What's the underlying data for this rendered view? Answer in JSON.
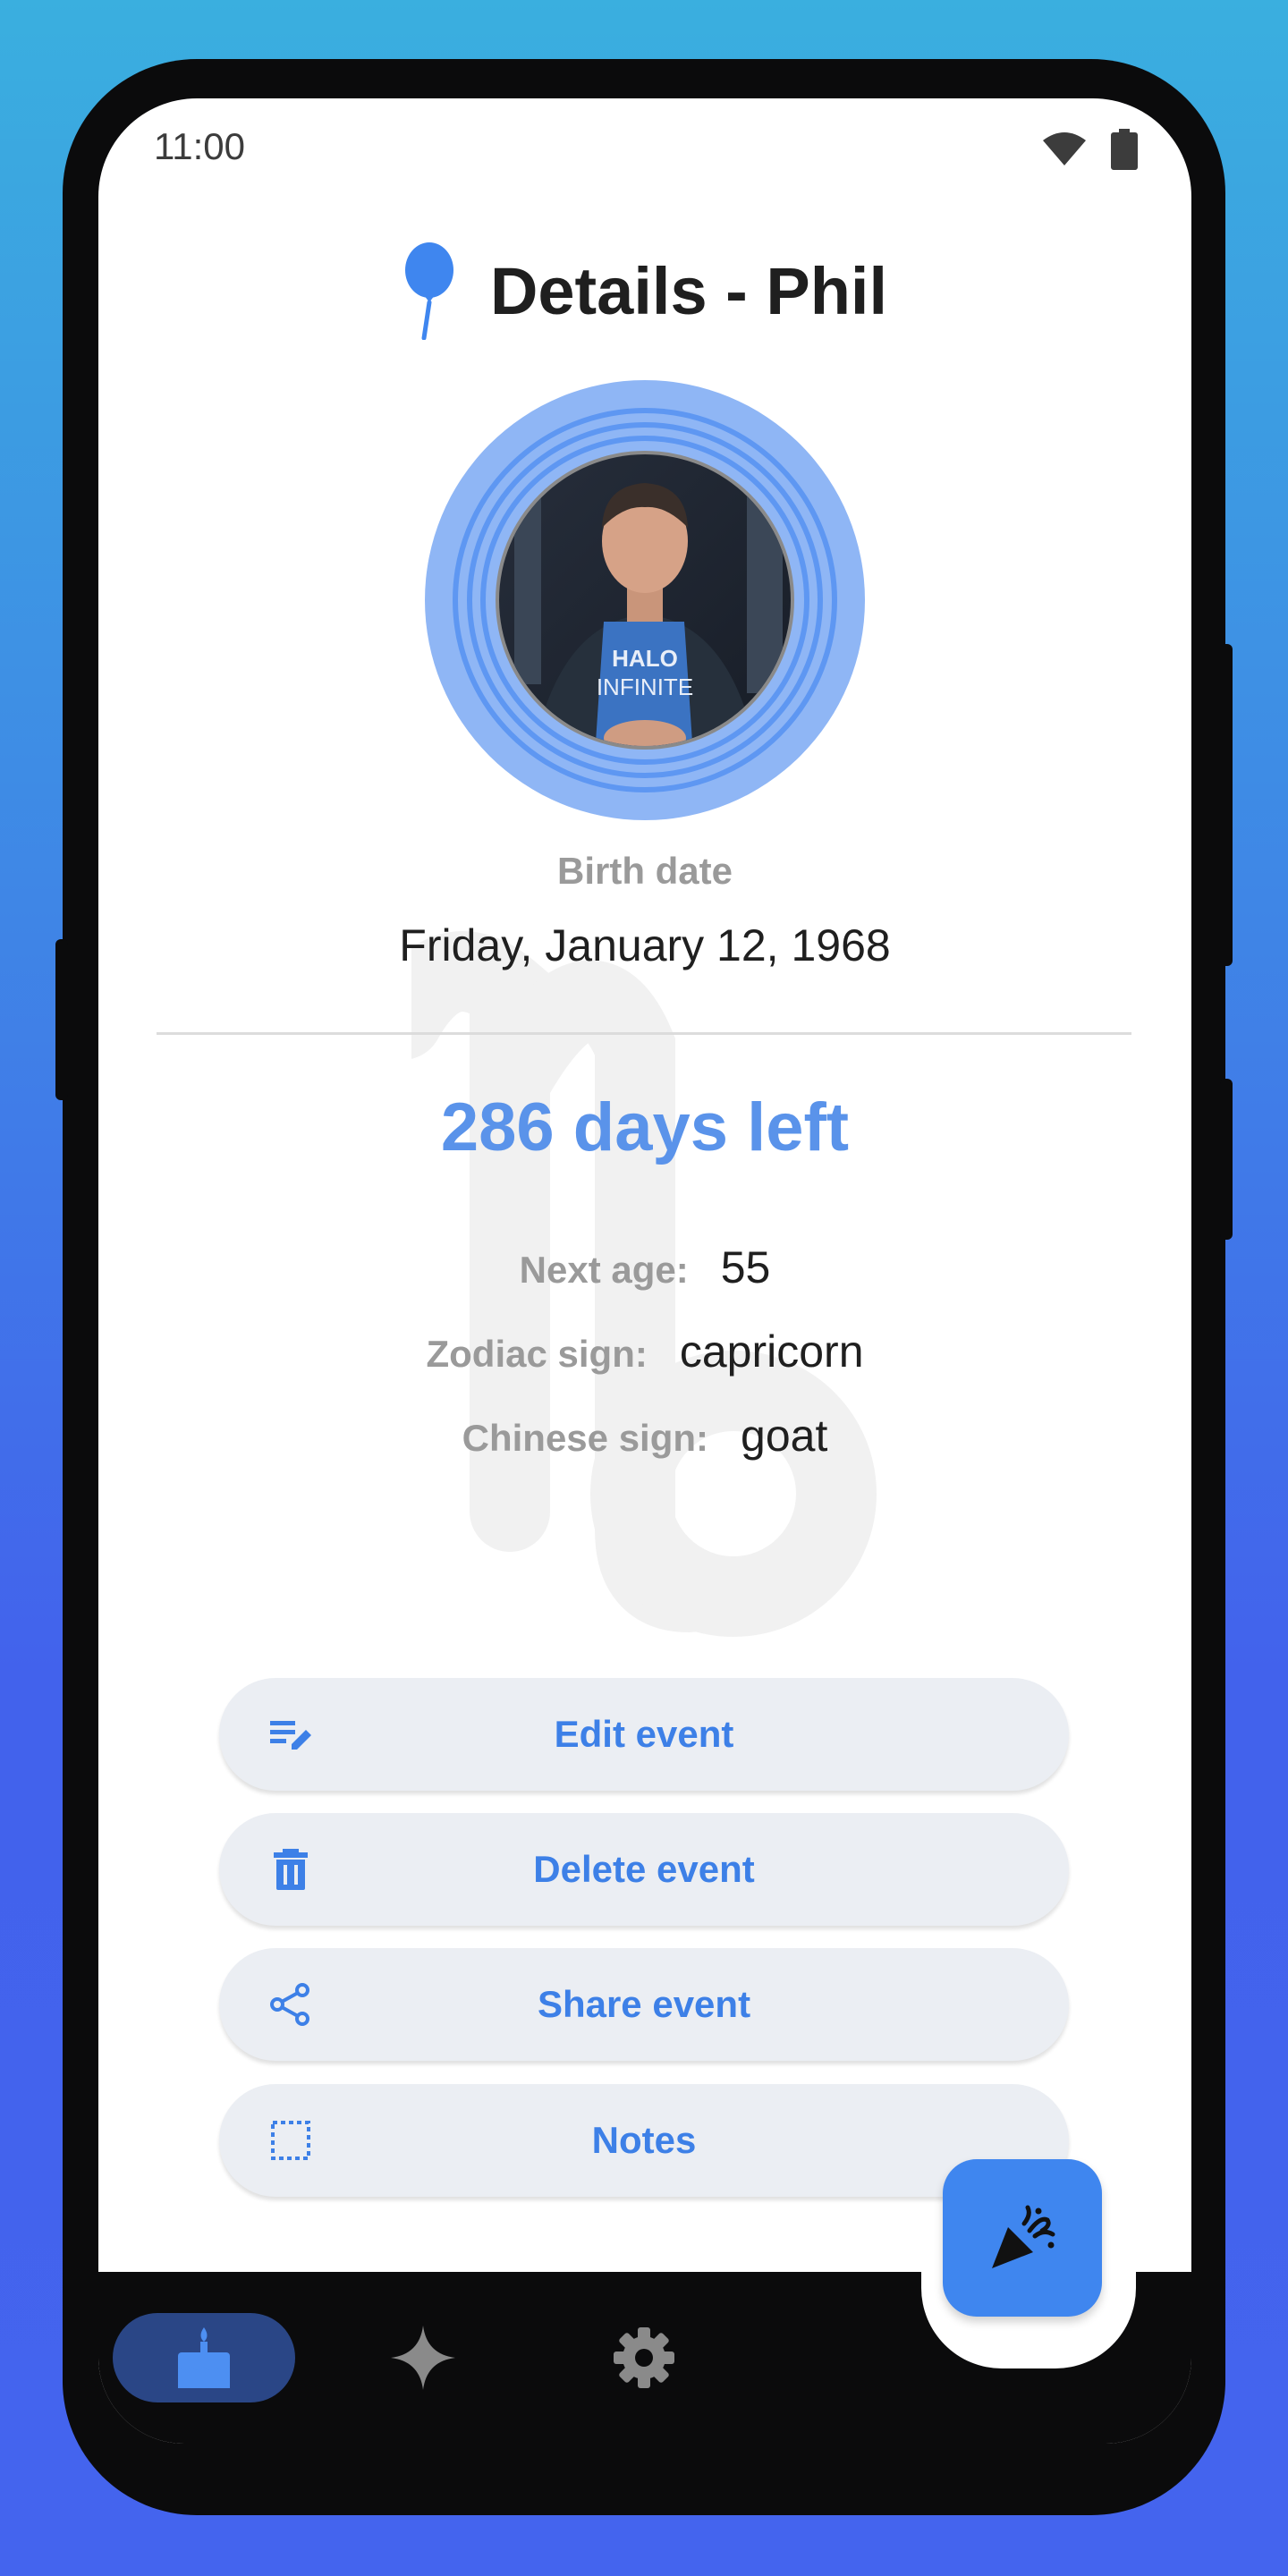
{
  "status_bar": {
    "time": "11:00"
  },
  "header": {
    "title": "Details - Phil"
  },
  "birth": {
    "label": "Birth date",
    "value": "Friday, January 12, 1968"
  },
  "countdown": {
    "text": "286 days left"
  },
  "info": [
    {
      "label": "Next age:",
      "value": "55"
    },
    {
      "label": "Zodiac sign:",
      "value": "capricorn"
    },
    {
      "label": "Chinese sign:",
      "value": "goat"
    }
  ],
  "actions": {
    "edit": "Edit event",
    "delete": "Delete event",
    "share": "Share event",
    "notes": "Notes"
  },
  "colors": {
    "accent": "#3d80e7",
    "days_left": "#5a93ea",
    "avatar_ring": "#8fb6f5",
    "nav_active": "#2a4686",
    "fab": "#3f86ef"
  },
  "icons": [
    "balloon-icon",
    "wifi-icon",
    "battery-icon",
    "capricorn-icon",
    "edit-icon",
    "delete-icon",
    "share-icon",
    "notes-icon",
    "party-popper-icon",
    "cake-icon",
    "sparkle-icon",
    "gear-icon"
  ]
}
